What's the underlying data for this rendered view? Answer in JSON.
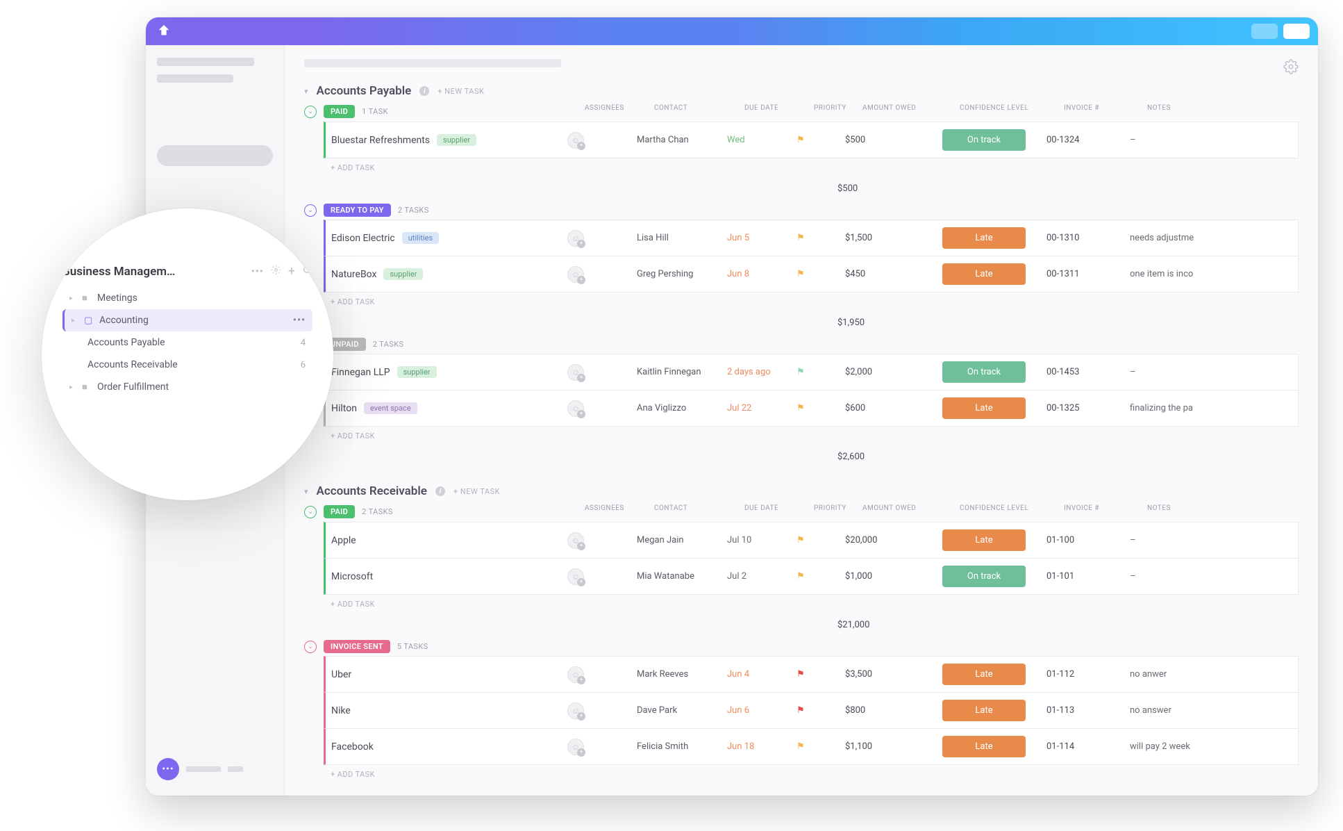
{
  "sidebar_overlay": {
    "title": "Business Managem…",
    "items": [
      {
        "label": "Meetings",
        "icon": "folder",
        "level": 1,
        "active": false
      },
      {
        "label": "Accounting",
        "icon": "folder-outline",
        "level": 1,
        "active": true
      },
      {
        "label": "Accounts Payable",
        "level": 2,
        "count": "4"
      },
      {
        "label": "Accounts Receivable",
        "level": 2,
        "count": "6"
      },
      {
        "label": "Order Fulfillment",
        "icon": "folder",
        "level": 1,
        "active": false
      }
    ]
  },
  "sections": [
    {
      "title": "Accounts Payable",
      "new_task_label": "+ NEW TASK",
      "columns": [
        "ASSIGNEES",
        "CONTACT",
        "DUE DATE",
        "PRIORITY",
        "AMOUNT OWED",
        "CONFIDENCE LEVEL",
        "INVOICE #",
        "NOTES"
      ],
      "groups": [
        {
          "status": "PAID",
          "color": "#4bbf6b",
          "count_label": "1 TASK",
          "tasks": [
            {
              "name": "Bluestar Refreshments",
              "tag": "supplier",
              "tag_class": "supplier",
              "contact": "Martha Chan",
              "due": "Wed",
              "due_class": "gr",
              "flag": "#f0b84a",
              "amount": "$500",
              "confidence": "On track",
              "conf_class": "on",
              "invoice": "00-1324",
              "notes": "–"
            }
          ],
          "subtotal": "$500"
        },
        {
          "status": "READY TO PAY",
          "color": "#7b68ee",
          "count_label": "2 TASKS",
          "tasks": [
            {
              "name": "Edison Electric",
              "tag": "utilities",
              "tag_class": "utilities",
              "contact": "Lisa Hill",
              "due": "Jun 5",
              "due_class": "or",
              "flag": "#f0b84a",
              "amount": "$1,500",
              "confidence": "Late",
              "conf_class": "late",
              "invoice": "00-1310",
              "notes": "needs adjustme"
            },
            {
              "name": "NatureBox",
              "tag": "supplier",
              "tag_class": "supplier",
              "contact": "Greg Pershing",
              "due": "Jun 8",
              "due_class": "or",
              "flag": "#f0b84a",
              "amount": "$450",
              "confidence": "Late",
              "conf_class": "late",
              "invoice": "00-1311",
              "notes": "one item is inco"
            }
          ],
          "subtotal": "$1,950"
        },
        {
          "status": "UNPAID",
          "color": "#b8b8b8",
          "count_label": "2 TASKS",
          "tasks": [
            {
              "name": "Finnegan LLP",
              "tag": "supplier",
              "tag_class": "supplier",
              "contact": "Kaitlin Finnegan",
              "due": "2 days ago",
              "due_class": "or",
              "flag": "#8ed6b0",
              "amount": "$2,000",
              "confidence": "On track",
              "conf_class": "on",
              "invoice": "00-1453",
              "notes": "–"
            },
            {
              "name": "Hilton",
              "tag": "event space",
              "tag_class": "eventspace",
              "contact": "Ana Viglizzo",
              "due": "Jul 22",
              "due_class": "or",
              "flag": "#f0b84a",
              "amount": "$600",
              "confidence": "Late",
              "conf_class": "late",
              "invoice": "00-1325",
              "notes": "finalizing the pa"
            }
          ],
          "subtotal": "$2,600"
        }
      ]
    },
    {
      "title": "Accounts Receivable",
      "new_task_label": "+ NEW TASK",
      "columns": [
        "ASSIGNEES",
        "CONTACT",
        "DUE DATE",
        "PRIORITY",
        "AMOUNT OWED",
        "CONFIDENCE LEVEL",
        "INVOICE #",
        "NOTES"
      ],
      "groups": [
        {
          "status": "PAID",
          "color": "#4bbf6b",
          "count_label": "2 TASKS",
          "tasks": [
            {
              "name": "Apple",
              "contact": "Megan Jain",
              "due": "Jul 10",
              "due_class": "gy",
              "flag": "#f0b84a",
              "amount": "$20,000",
              "confidence": "Late",
              "conf_class": "late",
              "invoice": "01-100",
              "notes": "–"
            },
            {
              "name": "Microsoft",
              "contact": "Mia Watanabe",
              "due": "Jul 2",
              "due_class": "gy",
              "flag": "#f0b84a",
              "amount": "$1,000",
              "confidence": "On track",
              "conf_class": "on",
              "invoice": "01-101",
              "notes": "–"
            }
          ],
          "subtotal": "$21,000"
        },
        {
          "status": "INVOICE SENT",
          "color": "#e86a8f",
          "count_label": "5 TASKS",
          "tasks": [
            {
              "name": "Uber",
              "contact": "Mark Reeves",
              "due": "Jun 4",
              "due_class": "or",
              "flag": "#e84a4a",
              "amount": "$3,500",
              "confidence": "Late",
              "conf_class": "late",
              "invoice": "01-112",
              "notes": "no anwer"
            },
            {
              "name": "Nike",
              "contact": "Dave Park",
              "due": "Jun 6",
              "due_class": "or",
              "flag": "#e84a4a",
              "amount": "$800",
              "confidence": "Late",
              "conf_class": "late",
              "invoice": "01-113",
              "notes": "no answer"
            },
            {
              "name": "Facebook",
              "contact": "Felicia Smith",
              "due": "Jun 18",
              "due_class": "or",
              "flag": "#f0b84a",
              "amount": "$1,100",
              "confidence": "Late",
              "conf_class": "late",
              "invoice": "01-114",
              "notes": "will pay 2 week"
            }
          ]
        }
      ]
    }
  ],
  "labels": {
    "add_task": "+ ADD TASK"
  }
}
